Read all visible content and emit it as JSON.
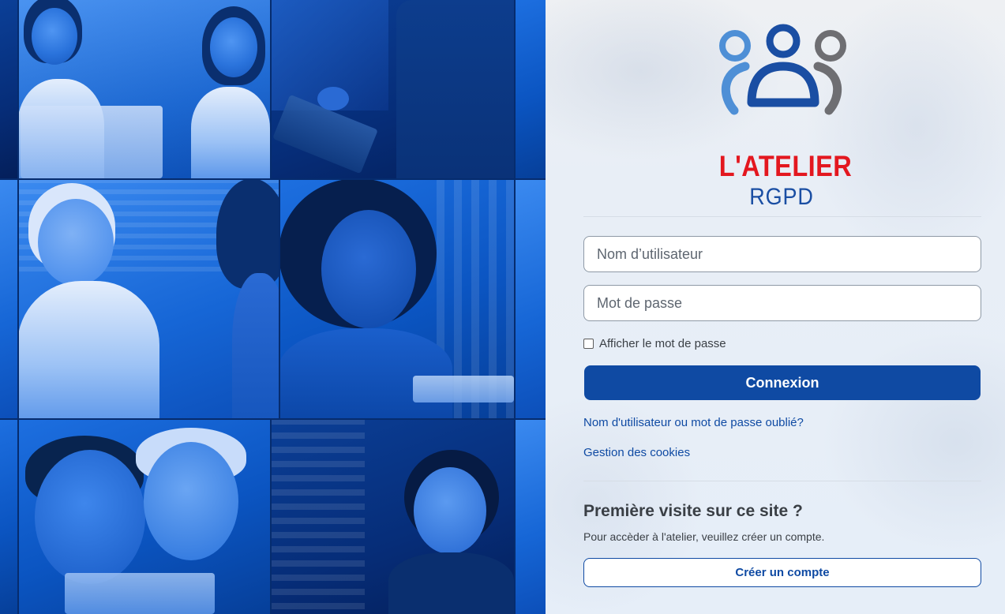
{
  "brand": {
    "title": "L'ATELIER",
    "subtitle": "RGPD",
    "title_color": "#e3171f",
    "subtitle_color": "#1a4ea3"
  },
  "login": {
    "username_placeholder": "Nom d’utilisateur",
    "password_placeholder": "Mot de passe",
    "username_value": "",
    "password_value": "",
    "show_password_label": "Afficher le mot de passe",
    "show_password_checked": false,
    "submit_label": "Connexion",
    "forgot_link": "Nom d'utilisateur ou mot de passe oublié?",
    "cookies_link": "Gestion des cookies"
  },
  "first_visit": {
    "title": "Première visite sur ce site ?",
    "text": "Pour accèder à l'atelier, veuillez créer un compte.",
    "create_account_label": "Créer un compte"
  },
  "colors": {
    "accent": "#0f4aa3",
    "collage_tint": "#0a4fae",
    "panel_background": "#e9f0f8"
  }
}
